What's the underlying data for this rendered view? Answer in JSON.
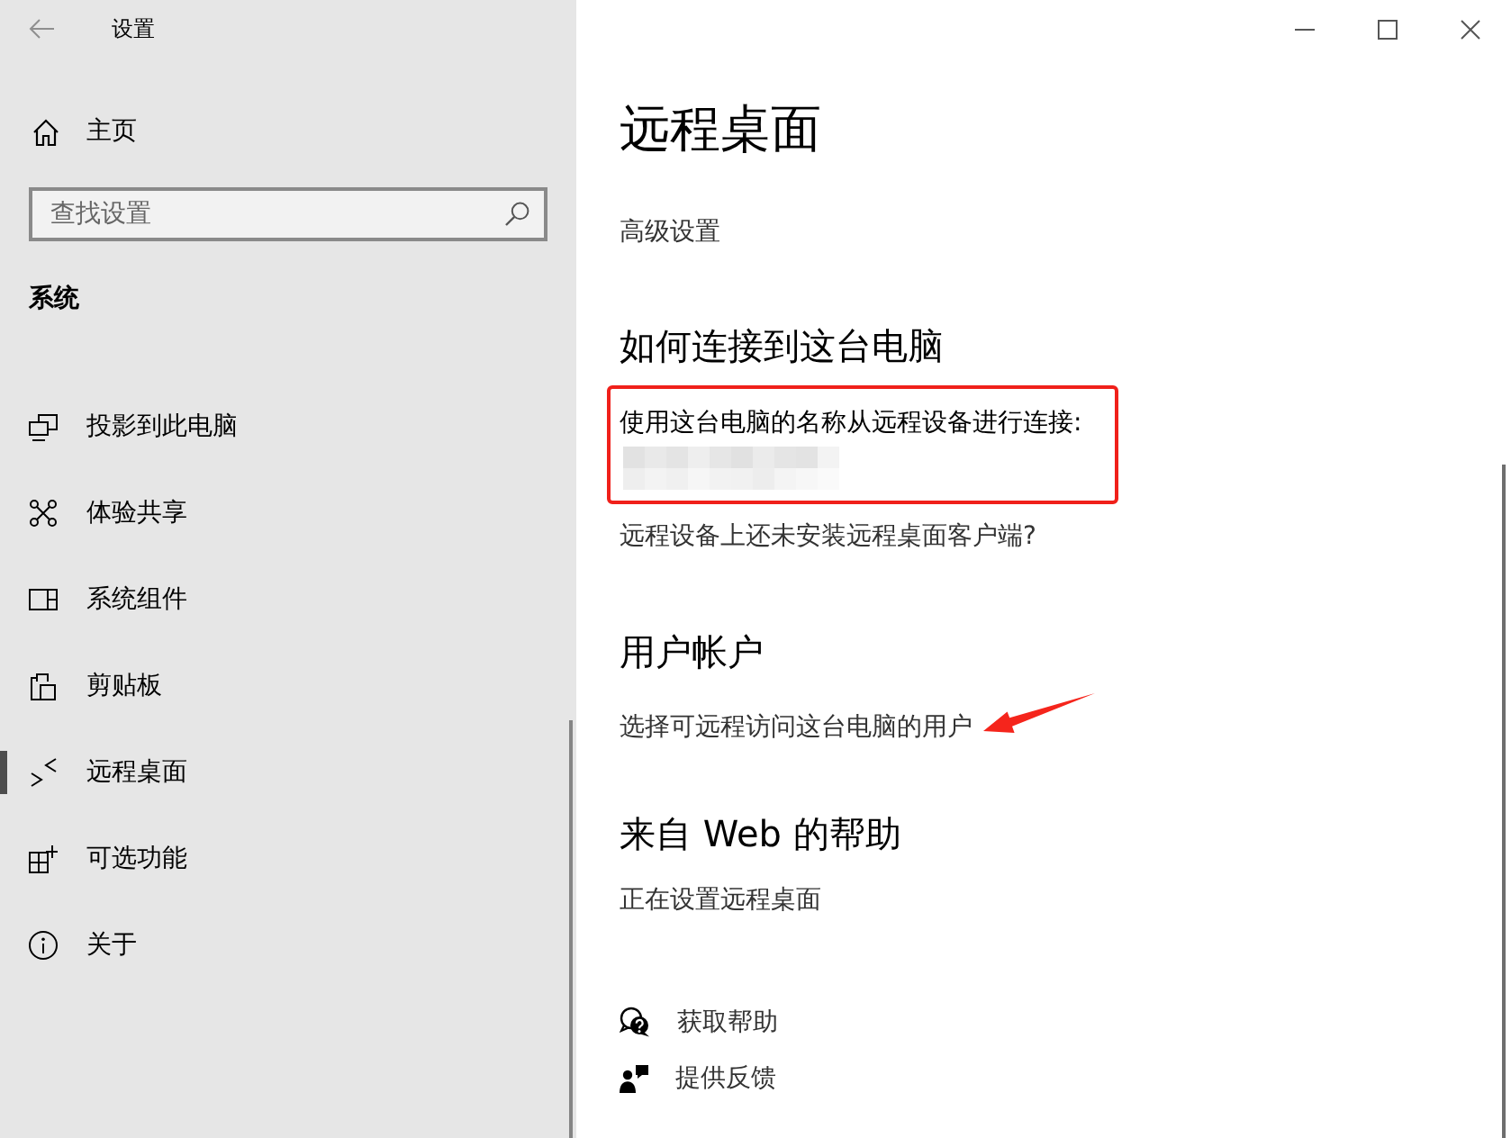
{
  "window": {
    "title": "设置"
  },
  "sidebar": {
    "home": "主页",
    "search": {
      "placeholder": "查找设置"
    },
    "section": "系统",
    "items": [
      {
        "label": "投影到此电脑",
        "selected": false
      },
      {
        "label": "体验共享",
        "selected": false
      },
      {
        "label": "系统组件",
        "selected": false
      },
      {
        "label": "剪贴板",
        "selected": false
      },
      {
        "label": "远程桌面",
        "selected": true
      },
      {
        "label": "可选功能",
        "selected": false
      },
      {
        "label": "关于",
        "selected": false
      }
    ]
  },
  "page": {
    "title": "远程桌面",
    "advanced_link": "高级设置"
  },
  "connect": {
    "heading": "如何连接到这台电脑",
    "instruction": "使用这台电脑的名称从远程设备进行连接:",
    "highlighted": true,
    "client_link": "远程设备上还未安装远程桌面客户端?"
  },
  "user_accounts": {
    "heading": "用户帐户",
    "link": "选择可远程访问这台电脑的用户",
    "arrow": true
  },
  "web_help": {
    "heading": "来自 Web 的帮助",
    "link": "正在设置远程桌面"
  },
  "support_links": [
    "获取帮助",
    "提供反馈"
  ]
}
